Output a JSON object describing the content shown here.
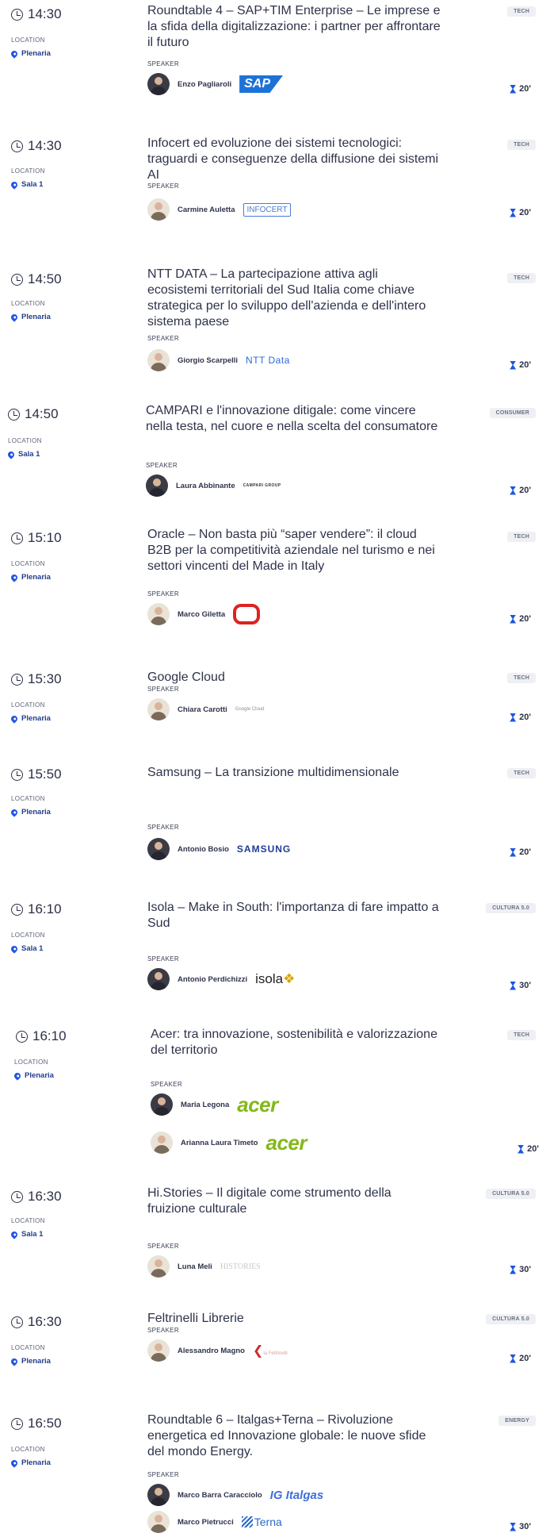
{
  "common": {
    "location_label": "LOCATION",
    "speaker_label": "SPEAKER"
  },
  "sessions": [
    {
      "time": "14:30",
      "location": "Plenaria",
      "tag": "TECH",
      "duration": "20'",
      "title": "Roundtable 4 – SAP+TIM Enterprise – Le imprese e la sfida della digitalizzazione: i partner per affrontare il futuro",
      "speakers": [
        {
          "name": "Enzo Pagliaroli",
          "company_logo": "SAP"
        }
      ]
    },
    {
      "time": "14:30",
      "location": "Sala 1",
      "tag": "TECH",
      "duration": "20'",
      "title": "Infocert ed evoluzione dei sistemi tecnologici: traguardi e conseguenze della diffusione dei sistemi AI",
      "speakers": [
        {
          "name": "Carmine Auletta",
          "company_logo": "INFOCERT"
        }
      ]
    },
    {
      "time": "14:50",
      "location": "Plenaria",
      "tag": "TECH",
      "duration": "20'",
      "title": "NTT DATA – La partecipazione attiva agli ecosistemi territoriali del Sud Italia come chiave strategica per lo sviluppo dell'azienda e dell'intero sistema paese",
      "speakers": [
        {
          "name": "Giorgio Scarpelli",
          "company_logo": "NTT Data"
        }
      ]
    },
    {
      "time": "14:50",
      "location": "Sala 1",
      "tag": "CONSUMER",
      "duration": "20'",
      "title": "CAMPARI e l'innovazione ditigale: come vincere nella testa, nel cuore e nella scelta del consumatore",
      "speakers": [
        {
          "name": "Laura Abbinante",
          "company_logo": "CAMPARI GROUP"
        }
      ]
    },
    {
      "time": "15:10",
      "location": "Plenaria",
      "tag": "TECH",
      "duration": "20'",
      "title": "Oracle – Non basta più “saper vendere”: il cloud B2B per la competitività aziendale nel turismo e nei settori vincenti del Made in Italy",
      "speakers": [
        {
          "name": "Marco Giletta",
          "company_logo": "ORACLE"
        }
      ]
    },
    {
      "time": "15:30",
      "location": "Plenaria",
      "tag": "TECH",
      "duration": "20'",
      "title": "Google Cloud",
      "speakers": [
        {
          "name": "Chiara Carotti",
          "company_logo": "Google Cloud"
        }
      ]
    },
    {
      "time": "15:50",
      "location": "Plenaria",
      "tag": "TECH",
      "duration": "20'",
      "title": "Samsung – La transizione multidimensionale",
      "speakers": [
        {
          "name": "Antonio Bosio",
          "company_logo": "SAMSUNG"
        }
      ]
    },
    {
      "time": "16:10",
      "location": "Sala 1",
      "tag": "CULTURA 5.0",
      "duration": "30'",
      "title": "Isola – Make in South: l'importanza di fare impatto a Sud",
      "speakers": [
        {
          "name": "Antonio Perdichizzi",
          "company_logo": "isola"
        }
      ]
    },
    {
      "time": "16:10",
      "location": "Plenaria",
      "tag": "TECH",
      "duration": "20'",
      "title": "Acer: tra innovazione, sostenibilità e valorizzazione del territorio",
      "speakers": [
        {
          "name": "Maria Legona",
          "company_logo": "acer"
        },
        {
          "name": "Arianna Laura Timeto",
          "company_logo": "acer"
        }
      ]
    },
    {
      "time": "16:30",
      "location": "Sala 1",
      "tag": "CULTURA 5.0",
      "duration": "30'",
      "title": "Hi.Stories – Il digitale come strumento della fruizione culturale",
      "speakers": [
        {
          "name": "Luna Meli",
          "company_logo": "HISTORIES"
        }
      ]
    },
    {
      "time": "16:30",
      "location": "Plenaria",
      "tag": "CULTURA 5.0",
      "duration": "20'",
      "title": "Feltrinelli Librerie",
      "speakers": [
        {
          "name": "Alessandro Magno",
          "company_logo": "la Feltrinelli"
        }
      ]
    },
    {
      "time": "16:50",
      "location": "Plenaria",
      "tag": "ENERGY",
      "duration": "30'",
      "title": "Roundtable 6 – Italgas+Terna – Rivoluzione energetica ed Innovazione globale: le nuove sfide del mondo Energy.",
      "speakers": [
        {
          "name": "Marco Barra Caracciolo",
          "company_logo": "IG Italgas"
        },
        {
          "name": "Marco Pietrucci",
          "company_logo": "Terna"
        }
      ]
    }
  ]
}
